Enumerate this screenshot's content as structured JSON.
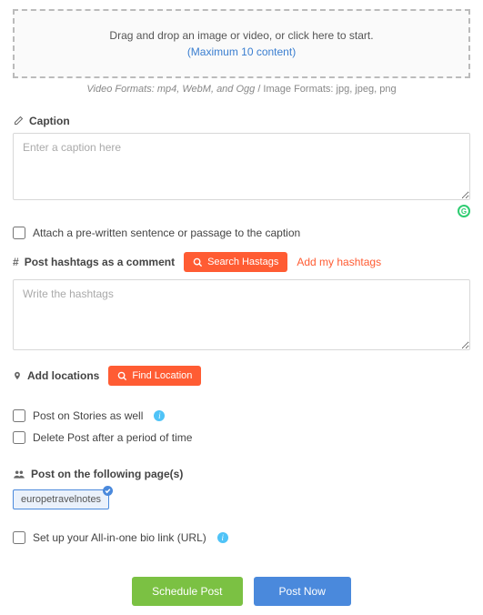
{
  "dropzone": {
    "prompt": "Drag and drop an image or video, or click here to start.",
    "max": "(Maximum 10 content)"
  },
  "formats": {
    "video_prefix": "Video Formats: ",
    "video": "mp4, WebM, and Ogg",
    "image_prefix": " / Image Formats: ",
    "image": "jpg, jpeg, png"
  },
  "caption": {
    "label": "Caption",
    "placeholder": "Enter a caption here"
  },
  "attach_sentence": {
    "label": "Attach a pre-written sentence or passage to the caption"
  },
  "hashtags": {
    "label": "Post hashtags as a comment",
    "search_btn": "Search Hastags",
    "add_link": "Add my hashtags",
    "placeholder": "Write the hashtags"
  },
  "location": {
    "label": "Add locations",
    "find_btn": "Find Location"
  },
  "stories": {
    "label": "Post on Stories as well"
  },
  "delete_after": {
    "label": "Delete Post after a period of time"
  },
  "pages": {
    "label": "Post on the following page(s)",
    "chip": "europetravelnotes"
  },
  "biolink": {
    "label": "Set up your All-in-one bio link (URL)"
  },
  "actions": {
    "schedule": "Schedule Post",
    "post_now": "Post Now"
  }
}
